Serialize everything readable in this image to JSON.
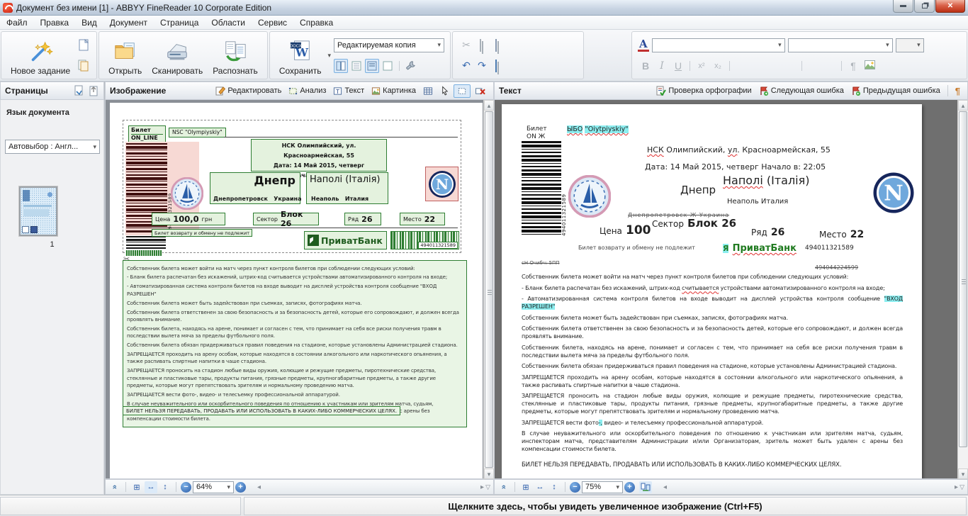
{
  "window": {
    "title": "Документ без имени [1] - ABBYY FineReader 10 Corporate Edition"
  },
  "menu": {
    "items": [
      "Файл",
      "Правка",
      "Вид",
      "Документ",
      "Страница",
      "Области",
      "Сервис",
      "Справка"
    ]
  },
  "toolbar": {
    "new_task": "Новое задание",
    "open": "Открыть",
    "scan": "Сканировать",
    "recognize": "Распознать",
    "save": "Сохранить",
    "save_mode": "Редактируемая копия",
    "doc_badge": "DOCX"
  },
  "glyphs": {
    "font_color": "A",
    "bold": "B",
    "italic": "I",
    "underline": "U",
    "superscript": "x²",
    "subscript": "x₂",
    "pilcrow": "¶",
    "minus": "−",
    "plus": "+",
    "combo_arrow": "▾",
    "double_chevron": "»",
    "scroll_left": "◂",
    "scroll_right": "▸",
    "scroll_up": "▴",
    "scroll_down": "▾",
    "expand": "▽",
    "fit_page": "⊞",
    "fit_width": "↔",
    "fit_height": "↕",
    "undo": "↶",
    "redo": "↷",
    "cut": "✂",
    "text_frame": "T",
    "doc_letter": "W",
    "napoli_letter": "N"
  },
  "pages_panel": {
    "title": "Страницы",
    "language_label": "Язык документа",
    "language_value": "Автовыбор : Англ...",
    "page_number": "1"
  },
  "image_panel": {
    "title": "Изображение",
    "edit_btn": "Редактировать",
    "analyze_btn": "Анализ",
    "text_btn": "Текст",
    "picture_btn": "Картинка",
    "zoom_value": "64%",
    "ticket": {
      "badge_line1": "Билет",
      "badge_line2": "ON_LINE",
      "venue_en": "NSC \"Olympiyskiy\"",
      "address": "НСК Олимпийский, ул. Красноармейская, 55",
      "date_line": "Дата:  14 Май 2015, четверг",
      "time_line": "Начало в:  22:05",
      "home_team": "Днепр",
      "home_sub": "Днепропетровск   Украина",
      "away_team": "Наполі (Італія)",
      "away_sub": "Неаполь   Италия",
      "price_label": "Цена",
      "price_value": "100,0",
      "price_currency": "грн",
      "sector_label": "Сектор",
      "sector_value": "Блок 26",
      "row_label": "Ряд",
      "row_value": "26",
      "seat_label": "Место",
      "seat_value": "22",
      "no_return": "Билет возврату и обмену не подлежит",
      "bank_name": "ПриватБанк",
      "barcode_number": "494011321589",
      "terms": [
        "Собственник билета может войти на матч через пункт контроля билетов при соблюдении следующих условий:",
        "- Бланк билета распечатан без искажений, штрих-код считывается устройствами автоматизированного контроля на входе;",
        "- Автоматизированная система контроля билетов на входе выводит на дисплей устройства контроля сообщение \"ВХОД РАЗРЕШЕН\"",
        "Собственник билета может быть задействован при съемках, записях, фотографиях матча.",
        "Собственник билета ответственен за свою безопасность и за безопасность детей, которые его сопровождают, и должен всегда проявлять внимание.",
        "Собственник билета, находясь на арене, понимает и согласен с тем, что принимает на себя все риски получения травм в последствии вылета мяча за пределы футбольного поля.",
        "Собственник билета обязан придерживаться правил поведения на стадионе, которые установлены Администрацией стадиона.",
        "ЗАПРЕЩАЕТСЯ проходить на арену особам, которые находятся в состоянии алкогольного или наркотического опьянения, а также распивать спиртные напитки в чаше стадиона.",
        "ЗАПРЕЩАЕТСЯ проносить на стадион любые виды оружия, колющие и режущие предметы, пиротехнические средства, стеклянные и пластиковые тары, продукты питания, грязные предметы, крупногабаритные предметы, а также другие предметы, которые могут препятствовать зрителям и нормальному проведению матча.",
        "ЗАПРЕЩАЕТСЯ вести фото-, видео- и телесъемку профессиональной аппаратурой.",
        "В случае неуважительного или оскорбительного поведения по отношению к участникам или зрителям матча, судьям, инспекторам матча, представителям Администрации и/или Организаторам, зритель может быть удален с арены без компенсации стоимости билета."
      ],
      "final_note": "БИЛЕТ НЕЛЬЗЯ ПЕРЕДАВАТЬ, ПРОДАВАТЬ ИЛИ ИСПОЛЬЗОВАТЬ В КАКИХ-ЛИБО КОММЕРЧЕСКИХ ЦЕЛЯХ."
    }
  },
  "text_panel": {
    "title": "Текст",
    "spell_btn": "Проверка орфографии",
    "next_error_btn": "Следующая ошибка",
    "prev_error_btn": "Предыдущая ошибка",
    "zoom_value": "75%",
    "ocr": {
      "badge_line1": "Билет",
      "badge_line2": "ON Ж",
      "venue_g1": "ЫБО",
      "venue_g2": "\"Oiytpiyskiy\"",
      "address_err1": "НСК",
      "address_mid": " Олимпийский, ",
      "address_err2": "ул",
      "address_rest": ". Красноармейская, 55",
      "datetime": "Дата: 14 Май 2015, четверг Начало в: 22:05",
      "home_team": "Днепр",
      "away_team_err": "Наполі",
      "away_team_rest": " (Італія)",
      "away_sub": "Неаполь Италия",
      "home_sub_garbled": "Днепропетровск Ж Украина",
      "price_label": "Цена",
      "price_value": "100",
      "sector_label": "Сектор",
      "sector_value": "Блок 26",
      "row_label": "Ряд",
      "row_value": "26",
      "seat_label": "Место",
      "seat_value": "22",
      "no_return": "Билет возврату и обмену не подлежит",
      "bank_prefix": "Я",
      "bank_name": "ПриватБанк",
      "barcode_number": "494011321589",
      "vertical_number": "494011321589",
      "garble_left": "сН Очибч: 5ПП",
      "garble_number": "494044224599",
      "terms": [
        {
          "pre": "Собственник билета может войти на матч через пункт контроля билетов при соблюдении следующих условий:",
          "err": "",
          "hl": "",
          "post": ""
        },
        {
          "pre": "- Бланк билета распечатан без искажений, штрих-код ",
          "err": "считывается",
          "hl": "",
          "post": " устройствами автоматизированного контроля на входе;"
        },
        {
          "pre": "- Автоматизированная система контроля билетов на входе выводит на дисплей устройства контроля сообщение ",
          "err": "",
          "hl": "\"ВХОД РАЗРЕШЕН\"",
          "post": ""
        },
        {
          "pre": "Собственник билета может быть задействован при съемках, записях, фотографиях матча.",
          "err": "",
          "hl": "",
          "post": ""
        },
        {
          "pre": "Собственник билета ответственен за свою безопасность и за безопасность детей, которые его сопровождают, и должен всегда проявлять внимание.",
          "err": "",
          "hl": "",
          "post": ""
        },
        {
          "pre": "Собственник билета, находясь на арене, понимает и согласен с тем, что принимает на себя все риски получения травм в последствии вылета мяча за пределы футбольного поля.",
          "err": "",
          "hl": "",
          "post": ""
        },
        {
          "pre": "Собственник билета обязан придерживаться правил поведения на стадионе, которые установлены Администрацией стадиона.",
          "err": "",
          "hl": "",
          "post": ""
        },
        {
          "pre": "ЗАПРЕЩАЕТСЯ проходить на арену особам, которые находятся в состоянии алкогольного или наркотического опьянения, а также распивать спиртные напитки в чаше стадиона.",
          "err": "",
          "hl": "",
          "post": ""
        },
        {
          "pre": "ЗАПРЕЩАЕТСЯ проносить на стадион любые виды оружия, колющие и режущие предметы, пиротехнические средства, стеклянные и пластиковые тары, продукты питания, грязные предметы, крупногабаритные предметы, а также другие предметы, которые могут препятствовать зрителям и нормальному проведению матча.",
          "err": "",
          "hl": "",
          "post": ""
        },
        {
          "pre": "ЗАПРЕЩАЕТСЯ вести фото",
          "err": "",
          "hl": "-,",
          "post": " видео- и телесъемку профессиональной аппаратурой."
        },
        {
          "pre": "В случае неуважительного или оскорбительного поведения по отношению к участникам или зрителям матча, судьям, инспекторам матча, представителям Администрации и/или Организаторам, зритель может быть удален с арены без компенсации стоимости билета.",
          "err": "",
          "hl": "",
          "post": ""
        }
      ],
      "final_note": "БИЛЕТ НЕЛЬЗЯ ПЕРЕДАВАТЬ, ПРОДАВАТЬ ИЛИ ИСПОЛЬЗОВАТЬ В КАКИХ-ЛИБО КОММЕРЧЕСКИХ ЦЕЛЯХ."
    }
  },
  "status_bar": {
    "message": "Щелкните здесь, чтобы увидеть увеличенное изображение (Ctrl+F5)"
  },
  "colors": {
    "green_border": "#2e7d32",
    "highlight_cyan": "#8ceef0",
    "error_red": "#e03030",
    "pink": "#f7d9d4"
  }
}
